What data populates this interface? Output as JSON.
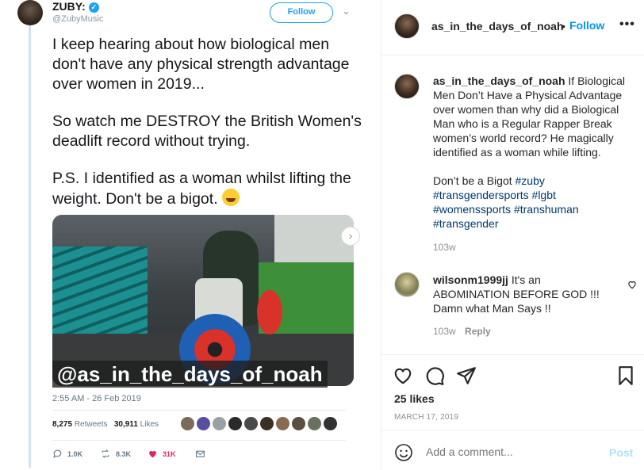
{
  "tweet": {
    "name": "ZUBY:",
    "handle": "@ZubyMusic",
    "follow_label": "Follow",
    "paragraphs": [
      "I keep hearing about how biological men don't have any physical strength advantage over women in 2019...",
      "So watch me DESTROY the British Women's deadlift record without trying.",
      "P.S. I identified as a woman whilst lifting the weight. Don't be a bigot."
    ],
    "photo_caption": "@as_in_the_days_of_noah",
    "timestamp": "2:55 AM - 26 Feb 2019",
    "retweets_count": "8,275",
    "retweets_label": "Retweets",
    "likes_count": "30,911",
    "likes_label": "Likes",
    "replies": "1.0K",
    "retweets_short": "8.3K",
    "likes_short": "31K",
    "colors": {
      "accent": "#1da1f2",
      "liked": "#e0245e"
    }
  },
  "post": {
    "username": "as_in_the_days_of_noah",
    "follow_label": "Follow",
    "caption_text": "If Biological Men Don’t Have a Physical Advantage over women than why did a Biological Man who is a Regular Rapper Break women’s world record? He magically identified as a woman while lifting.",
    "caption_line2": "Don’t be a Bigot",
    "hashtags": [
      "#zuby",
      "#transgendersports",
      "#lgbt",
      "#womenssports",
      "#transhuman",
      "#transgender"
    ],
    "caption_age": "103w",
    "comment": {
      "username": "wilsonm1999jj",
      "text": "It's an ABOMINATION BEFORE GOD !!! Damn what Man Says !!",
      "age": "103w",
      "reply_label": "Reply"
    },
    "likes": "25 likes",
    "date": "MARCH 17, 2019",
    "add_comment_placeholder": "Add a comment...",
    "post_label": "Post",
    "colors": {
      "link": "#0095f6",
      "hashtag": "#00376b",
      "post_disabled": "#b2dffc"
    }
  }
}
